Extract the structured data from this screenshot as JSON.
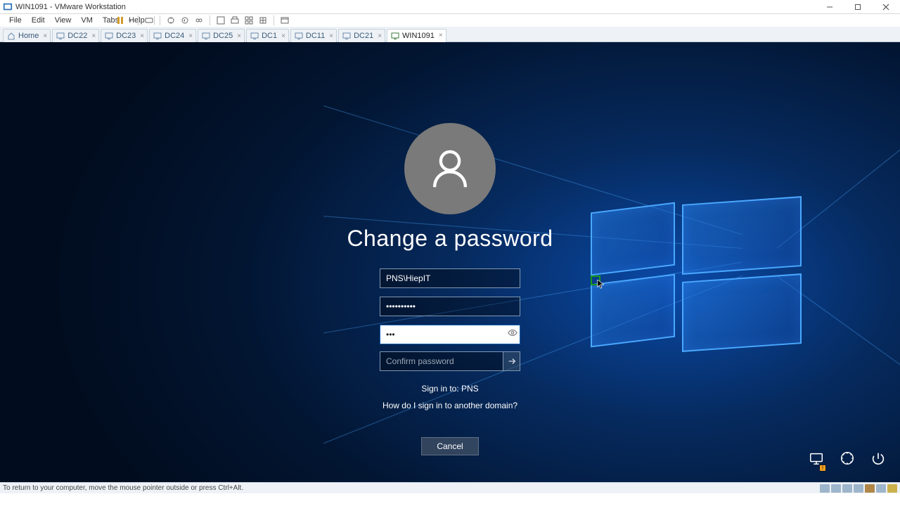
{
  "titlebar": {
    "text": "WIN1091 - VMware Workstation"
  },
  "menu": {
    "items": [
      "File",
      "Edit",
      "View",
      "VM",
      "Tabs",
      "Help"
    ]
  },
  "tabs": [
    {
      "label": "Home",
      "active": false,
      "home": true
    },
    {
      "label": "DC22",
      "active": false
    },
    {
      "label": "DC23",
      "active": false
    },
    {
      "label": "DC24",
      "active": false
    },
    {
      "label": "DC25",
      "active": false
    },
    {
      "label": "DC1",
      "active": false
    },
    {
      "label": "DC11",
      "active": false
    },
    {
      "label": "DC21",
      "active": false
    },
    {
      "label": "WIN1091",
      "active": true
    }
  ],
  "login": {
    "heading": "Change a password",
    "username_value": "PNS\\HiepIT",
    "old_password_value": "••••••••••",
    "new_password_value": "•••",
    "confirm_placeholder": "Confirm password",
    "sign_in_to": "Sign in to: PNS",
    "other_domain": "How do I sign in to another domain?",
    "cancel": "Cancel"
  },
  "statusbar": {
    "hint": "To return to your computer, move the mouse pointer outside or press Ctrl+Alt."
  },
  "icons": {
    "network": "network-icon",
    "ease": "ease-of-access-icon",
    "power": "power-icon"
  }
}
